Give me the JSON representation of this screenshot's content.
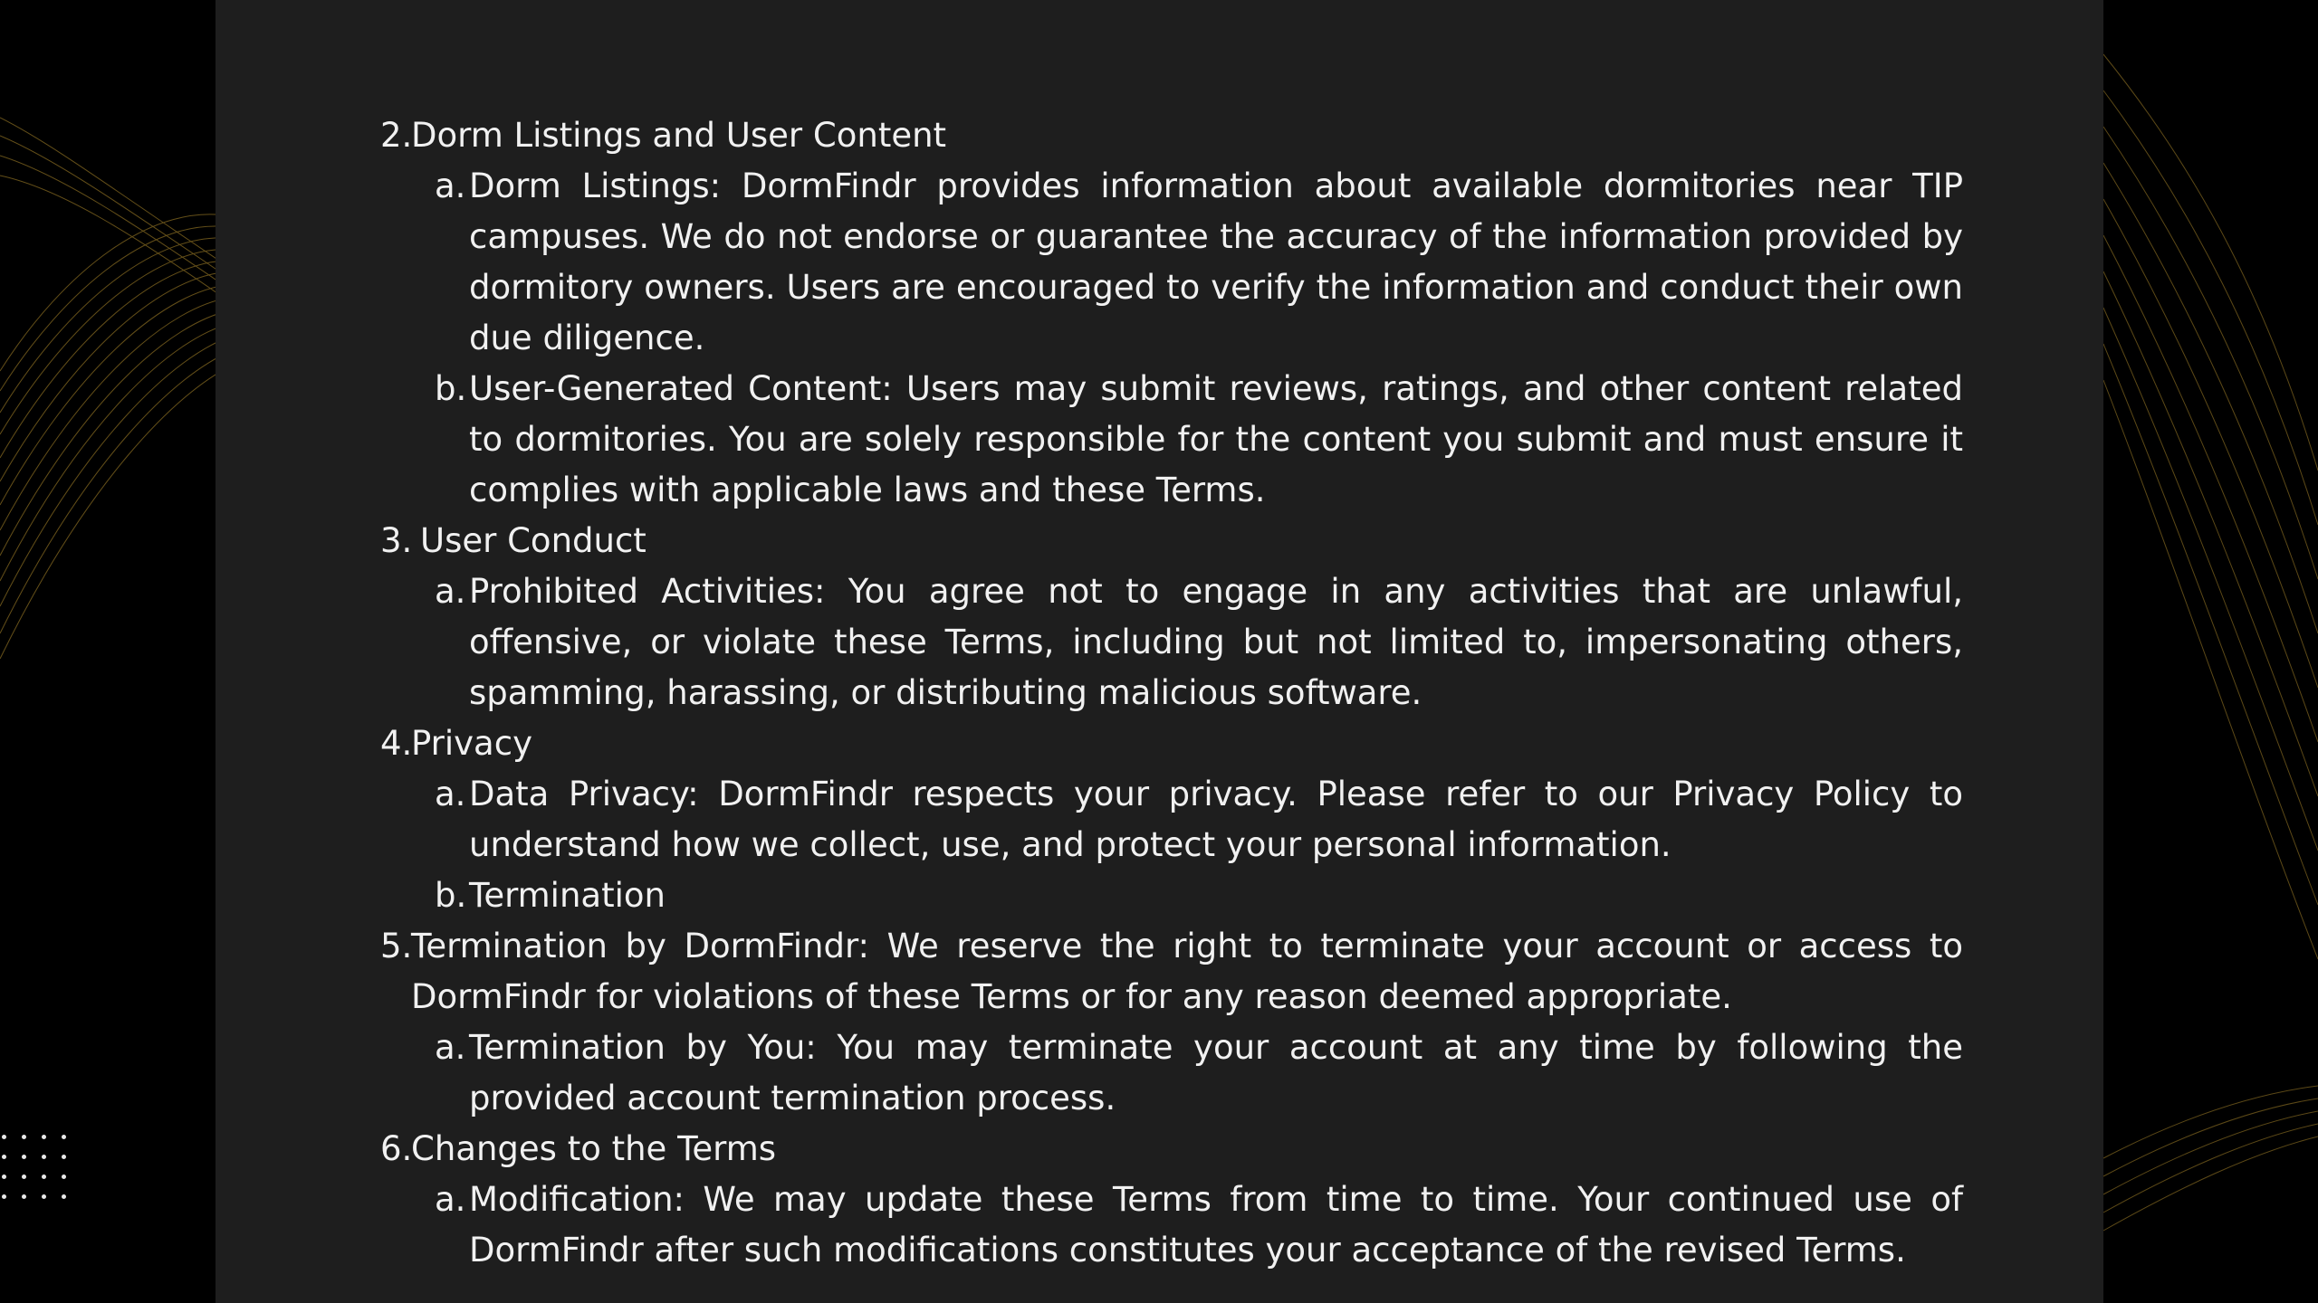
{
  "colors": {
    "page_background": "#000000",
    "panel_background": "#1e1e1e",
    "text": "#f1f1f1",
    "wave_accent": "#b8922e",
    "dots": "#e8e8e8"
  },
  "decorations": {
    "left_wave": "gold-line-wave",
    "right_wave": "gold-line-wave",
    "dot_grid": "white-dot-grid"
  },
  "terms": [
    {
      "number": "2.",
      "title": "Dorm Listings and User Content",
      "items": [
        {
          "marker": "a.",
          "text": "Dorm Listings: DormFindr provides information about available dormitories near TIP campuses. We do not endorse or guarantee the accuracy of the information provided by dormitory owners. Users are encouraged to verify the information and conduct their own due diligence."
        },
        {
          "marker": "b.",
          "text": "User-Generated Content: Users may submit reviews, ratings, and other content related to dormitories. You are solely responsible for the content you submit and must ensure it complies with applicable laws and these Terms."
        }
      ]
    },
    {
      "number": "3.",
      "title": "User Conduct",
      "items": [
        {
          "marker": "a.",
          "text": "Prohibited Activities: You agree not to engage in any activities that are unlawful, offensive, or violate these Terms, including but not limited to, impersonating others, spamming, harassing, or distributing malicious software."
        }
      ]
    },
    {
      "number": "4.",
      "title": "Privacy",
      "items": [
        {
          "marker": "a.",
          "text": "Data Privacy: DormFindr respects your privacy. Please refer to our Privacy Policy to understand how we collect, use, and protect your personal information."
        },
        {
          "marker": "b.",
          "text": "Termination"
        }
      ]
    },
    {
      "number": "5.",
      "title": "Termination by DormFindr: We reserve the right to terminate your account or access to DormFindr for violations of these Terms or for any reason deemed appropriate.",
      "items": [
        {
          "marker": "a.",
          "text": "Termination by You: You may terminate your account at any time by following the provided account termination process."
        }
      ]
    },
    {
      "number": "6.",
      "title": "Changes to the Terms",
      "items": [
        {
          "marker": "a.",
          "text": "Modification: We may update these Terms from time to time. Your continued use of DormFindr after such modifications constitutes your acceptance of the revised Terms."
        }
      ]
    }
  ]
}
